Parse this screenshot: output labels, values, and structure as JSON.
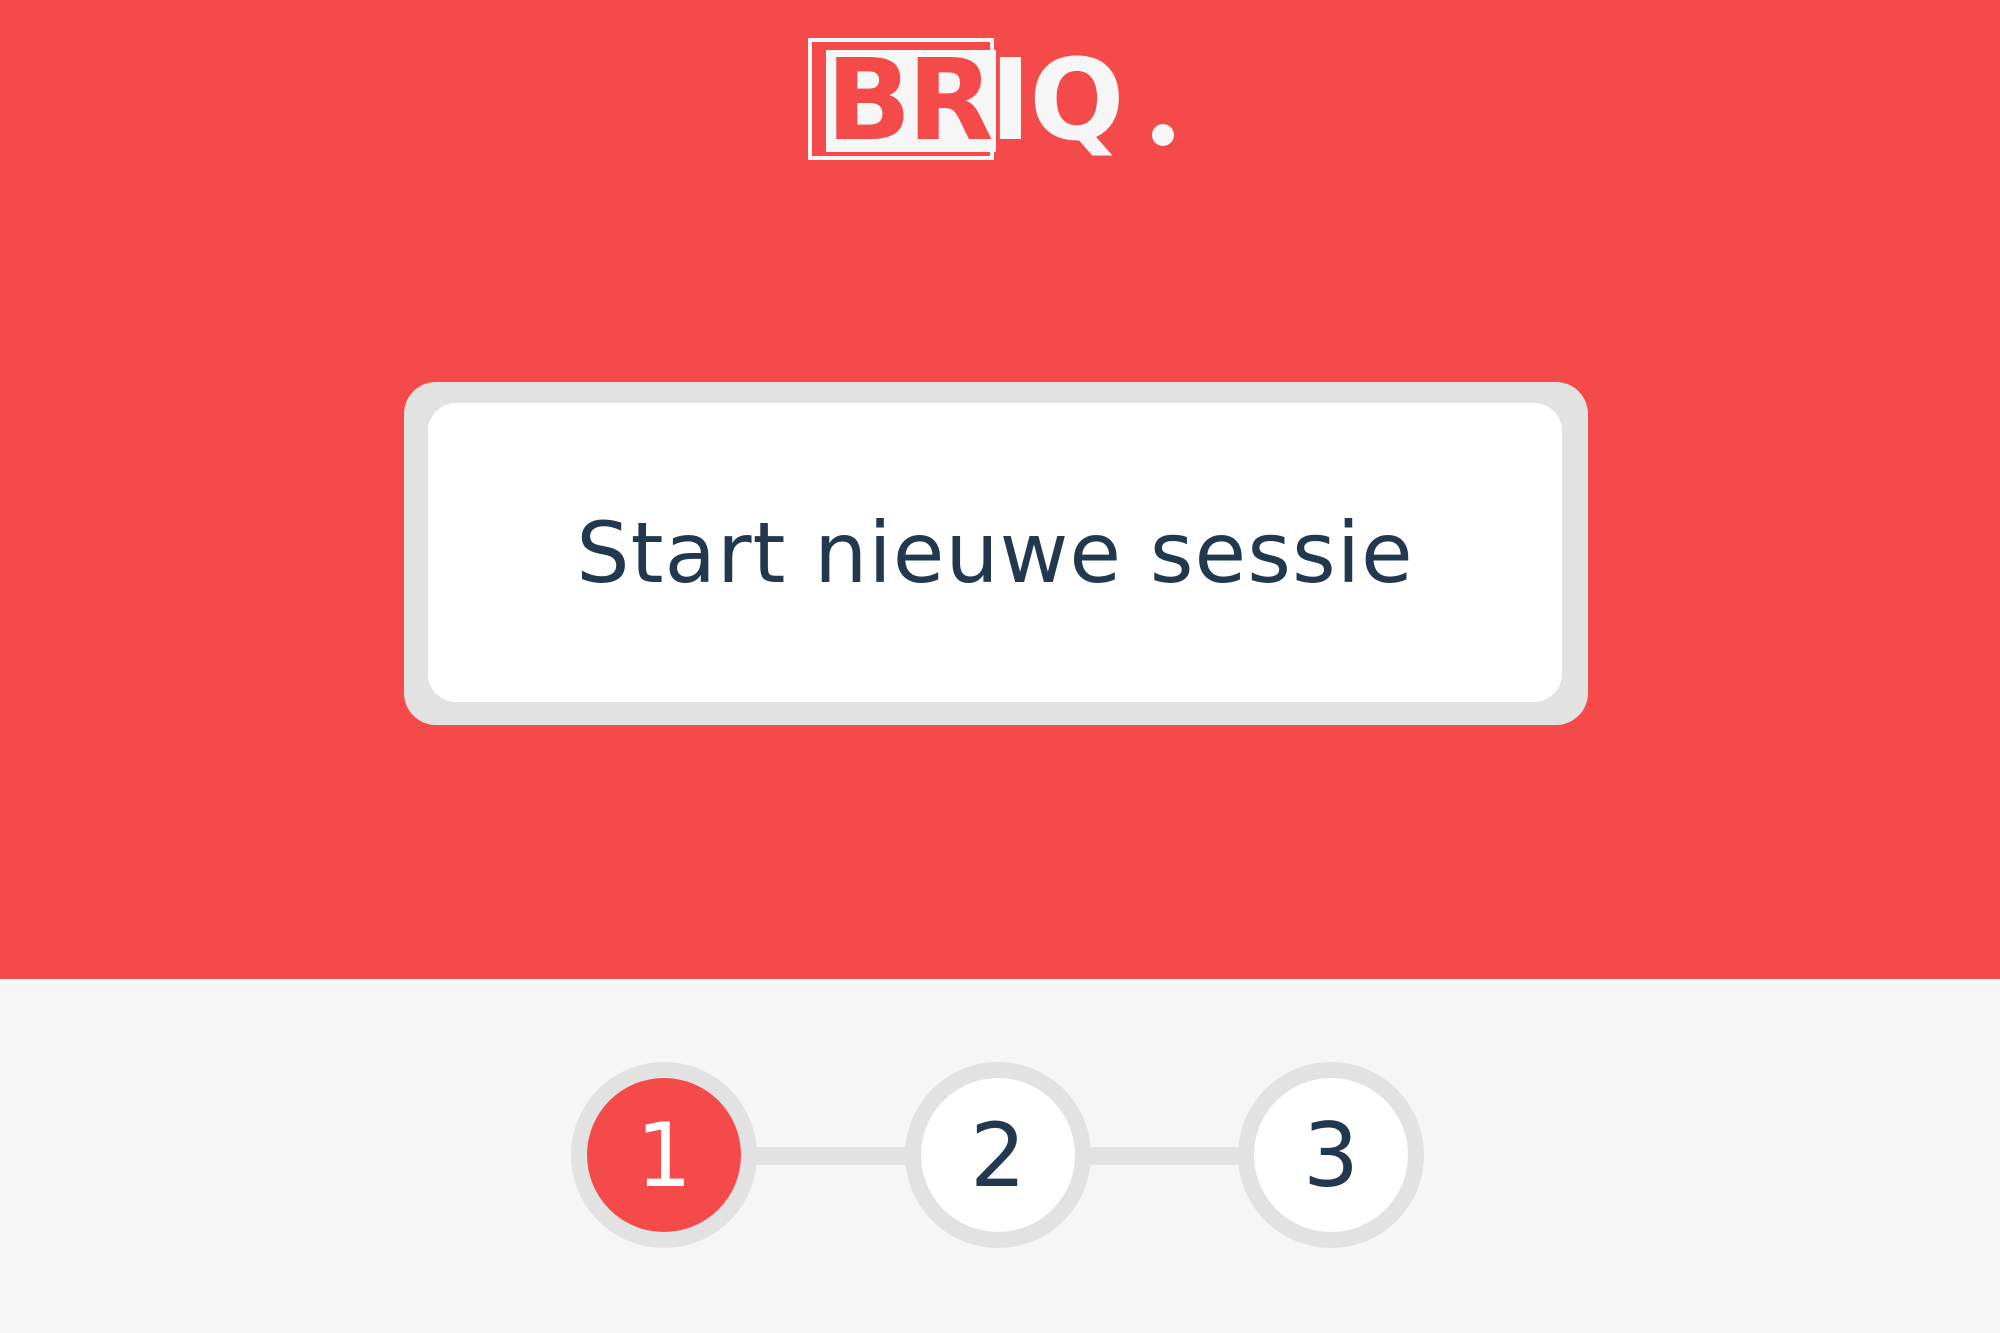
{
  "brand": {
    "logo_text": "BRIQ."
  },
  "main": {
    "start_button_label": "Start nieuwe sessie"
  },
  "stepper": {
    "steps": [
      {
        "label": "1",
        "active": true
      },
      {
        "label": "2",
        "active": false
      },
      {
        "label": "3",
        "active": false
      }
    ]
  },
  "colors": {
    "accent": "#f54a4a",
    "text": "#22384f",
    "background": "#f6f6f6",
    "border": "#e2e2e2"
  }
}
